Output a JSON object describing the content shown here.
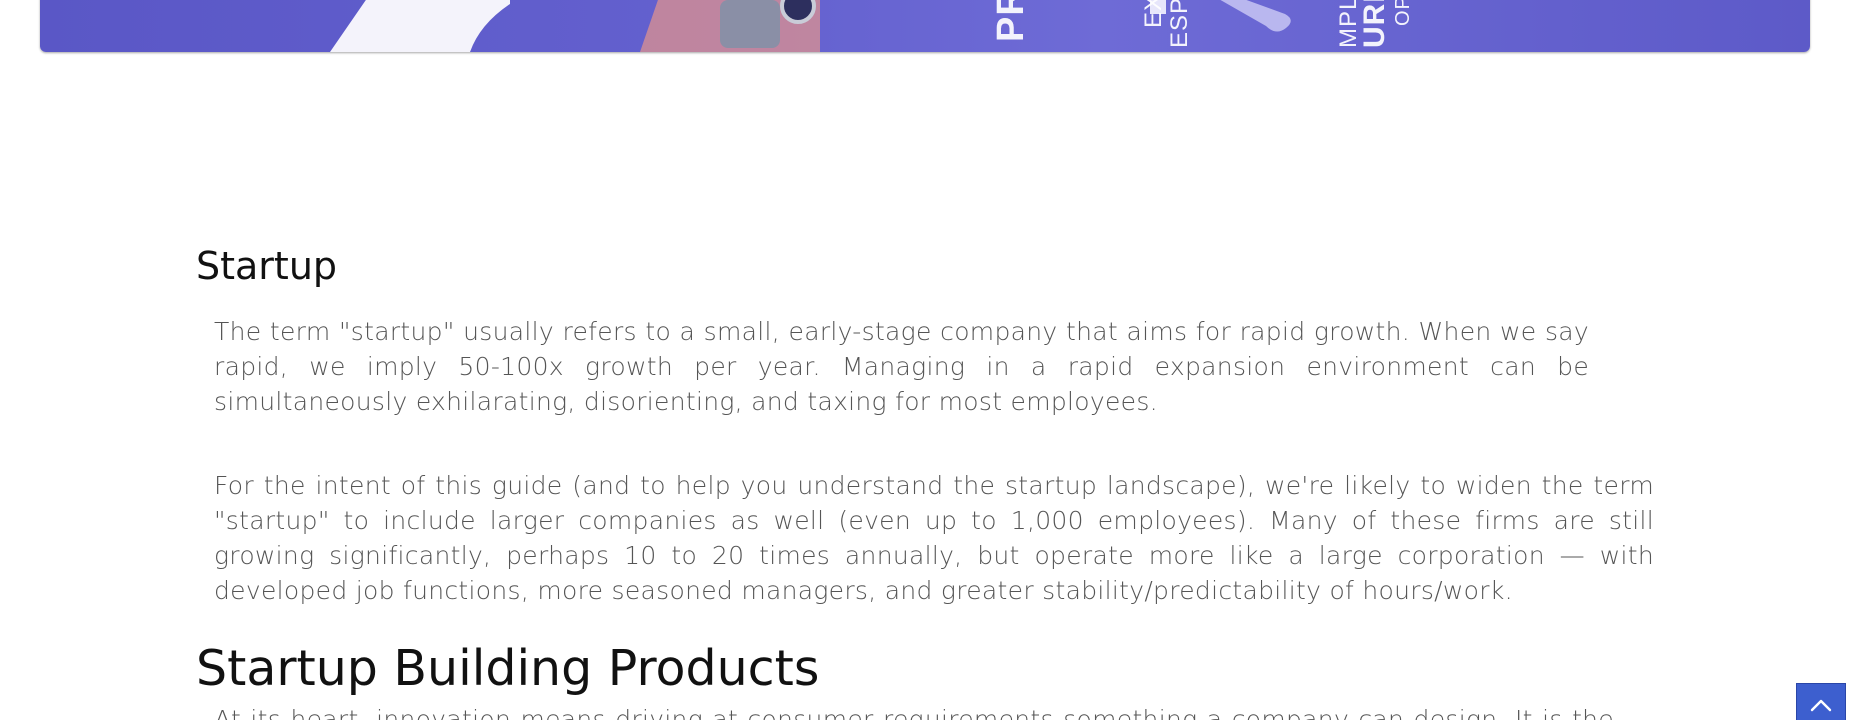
{
  "hero": {
    "words": [
      "PR",
      "EX",
      "ESPO",
      "MPL",
      "URR",
      "OP"
    ]
  },
  "article": {
    "section1": {
      "title": "Startup",
      "paragraphs": [
        "The term \"startup\" usually refers to a small, early-stage company that aims for rapid growth. When we say rapid, we imply 50-100x growth per year. Managing in a rapid expansion environment can be simultaneously exhilarating, disorienting, and taxing for most employees.",
        "For the intent of this guide (and to help you understand the startup landscape), we're likely to widen the term \"startup\" to include larger companies as well (even up to 1,000 employees). Many of these firms are still growing significantly, perhaps 10 to 20 times annually, but operate more like a large corporation — with developed job functions, more seasoned managers, and greater stability/predictability of hours/work."
      ]
    },
    "section2": {
      "title": "Startup Building Products",
      "partial_text": "At its heart, innovation means driving at consumer requirements something a company can design. It is the product a company makes that fits"
    }
  },
  "colors": {
    "hero_bg": "#6461cf",
    "scroll_button": "#3d5fcf",
    "body_text": "#555555",
    "heading_text": "#111111"
  },
  "icons": {
    "scroll_top": "chevron-up-icon"
  }
}
